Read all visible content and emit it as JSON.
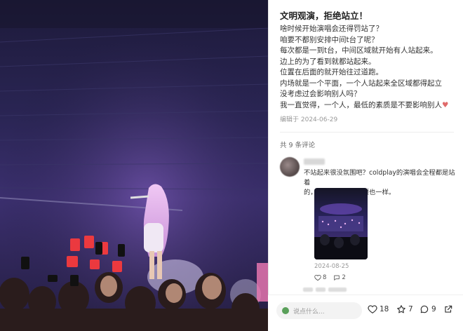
{
  "post": {
    "title": "文明观演，拒绝站立！",
    "lines": [
      "啥时候开始演唱会还得罚站了？",
      "咱要不都别安排中间t台了呢？",
      "每次都是一到t台，中间区域就开始有人站起来。",
      "边上的为了看到就都站起来。",
      "位置在后面的就开始往过道跑。",
      "内场就是一个平面，一个人站起来全区域都得起立",
      "没考虑过会影响别人吗？",
      "我一直觉得，一个人，最低的素质是不要影响别人"
    ],
    "date": "编辑于  2024-06-29"
  },
  "comments_header": "共 9 条评论",
  "comment": {
    "lines": [
      "不站起来很没氛围吧？coldplay的演唱会全程都是站着",
      "的，不止是内场，山顶也一样。"
    ],
    "date": "2024-08-25",
    "likes": "8",
    "replies": "2"
  },
  "bottom_bar": {
    "input_placeholder": "说点什么...",
    "likes": "18",
    "favorites": "7",
    "comments": "9"
  },
  "colors": {
    "stage_light": "#e07ad8",
    "led_sign": "#ff3b3b",
    "accent_like": "#333333"
  },
  "icons": [
    "heart-icon",
    "star-icon",
    "comment-bubble-icon",
    "share-icon",
    "reply-icon"
  ]
}
